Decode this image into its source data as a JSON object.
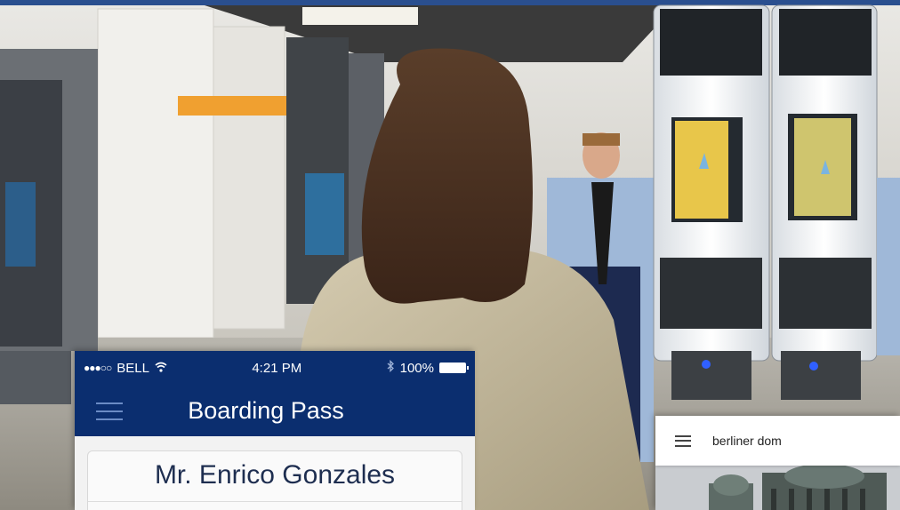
{
  "phone": {
    "status_bar": {
      "signal": "●●●○○",
      "carrier": "BELL",
      "wifi_icon": "wifi-icon",
      "time": "4:21 PM",
      "bluetooth_icon": "bluetooth-icon",
      "battery_percent": "100%"
    },
    "header": {
      "title": "Boarding Pass"
    },
    "card": {
      "passenger_name": "Mr. Enrico Gonzales"
    }
  },
  "maps": {
    "search_value": "berliner dom"
  },
  "colors": {
    "header_blue": "#0b2e6f",
    "kiosk_yellow": "#e8c64a"
  }
}
